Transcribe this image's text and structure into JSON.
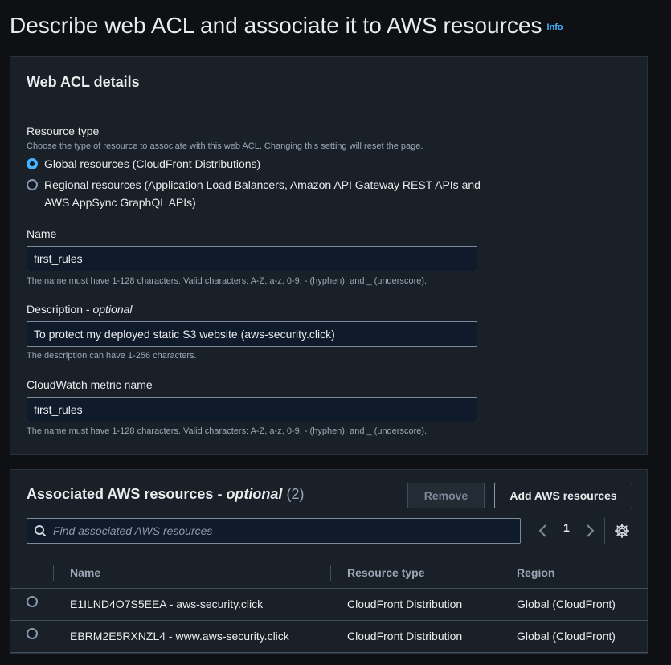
{
  "page": {
    "title": "Describe web ACL and associate it to AWS resources",
    "info_link": "Info"
  },
  "details": {
    "heading": "Web ACL details",
    "resource_type": {
      "label": "Resource type",
      "hint": "Choose the type of resource to associate with this web ACL. Changing this setting will reset the page.",
      "options": [
        {
          "label": "Global resources (CloudFront Distributions)",
          "selected": true
        },
        {
          "label_line1": "Regional resources (Application Load Balancers, Amazon API Gateway REST APIs and",
          "label_line2": "AWS AppSync GraphQL APIs)",
          "selected": false
        }
      ]
    },
    "name": {
      "label": "Name",
      "value": "first_rules",
      "hint": "The name must have 1-128 characters. Valid characters: A-Z, a-z, 0-9, - (hyphen), and _ (underscore)."
    },
    "description": {
      "label": "Description",
      "label_suffix": "optional",
      "value": "To protect my deployed static S3 website (aws-security.click)",
      "hint": "The description can have 1-256 characters."
    },
    "metric": {
      "label": "CloudWatch metric name",
      "value": "first_rules",
      "hint": "The name must have 1-128 characters. Valid characters: A-Z, a-z, 0-9, - (hyphen), and _ (underscore)."
    }
  },
  "resources": {
    "heading": "Associated AWS resources",
    "heading_suffix": "optional",
    "count": "(2)",
    "remove_label": "Remove",
    "add_label": "Add AWS resources",
    "search_placeholder": "Find associated AWS resources",
    "page_number": "1",
    "columns": [
      "Name",
      "Resource type",
      "Region"
    ],
    "rows": [
      {
        "name": "E1ILND4O7S5EEA - aws-security.click",
        "type": "CloudFront Distribution",
        "region": "Global (CloudFront)"
      },
      {
        "name": "EBRM2E5RXNZL4 - www.aws-security.click",
        "type": "CloudFront Distribution",
        "region": "Global (CloudFront)"
      }
    ]
  },
  "colors": {
    "background": "#0f1014",
    "panel": "#192027",
    "accent": "#42b4ff"
  },
  "icons": [
    "search-icon",
    "chevron-left-icon",
    "chevron-right-icon",
    "gear-icon"
  ]
}
